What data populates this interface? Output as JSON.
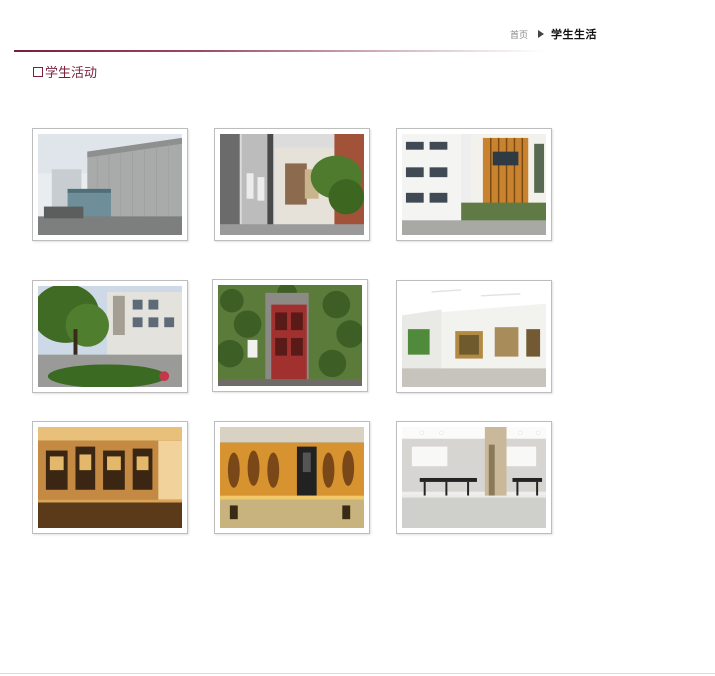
{
  "breadcrumb": {
    "home_label": "首页",
    "current_label": "学生生活"
  },
  "section": {
    "title": "学生活动"
  },
  "colors": {
    "accent": "#7a1f3a",
    "thumb_border": "#bdbdbd"
  },
  "gallery": {
    "photos": [
      {
        "subject": "campus-building-exterior"
      },
      {
        "subject": "building-entrance-with-palm"
      },
      {
        "subject": "atrium-courtyard"
      },
      {
        "subject": "building-with-trees"
      },
      {
        "subject": "ivy-wall-red-door"
      },
      {
        "subject": "white-art-gallery"
      },
      {
        "subject": "museum-display-cases"
      },
      {
        "subject": "exhibition-hall-lit"
      },
      {
        "subject": "hall-with-column"
      }
    ]
  }
}
